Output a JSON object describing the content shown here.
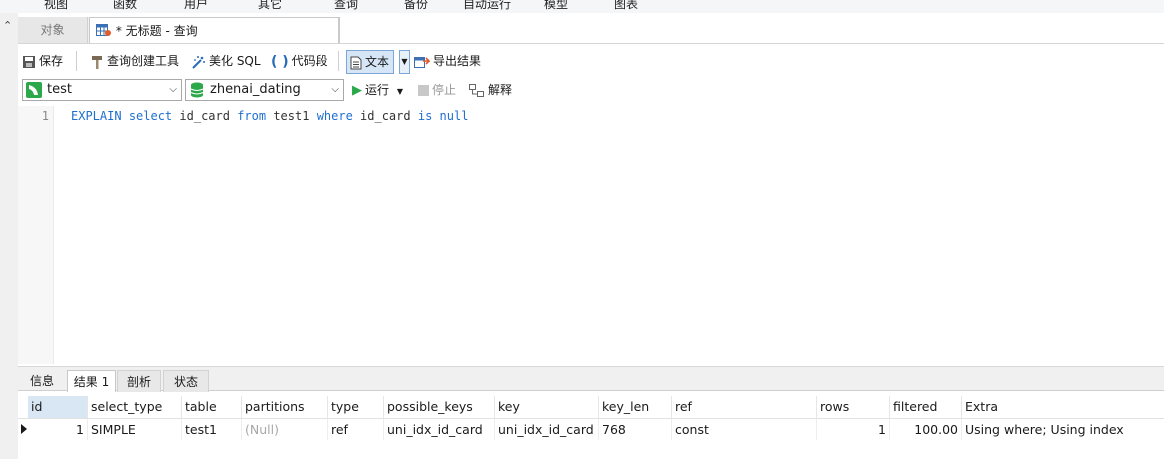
{
  "menu": {
    "items": [
      "视图",
      "函数",
      "用户",
      "其它",
      "查询",
      "备份",
      "自动运行",
      "模型",
      "图表"
    ]
  },
  "tabs": {
    "objects": "对象",
    "query": "* 无标题 - 查询"
  },
  "toolbar": {
    "save": "保存",
    "query_builder": "查询创建工具",
    "beautify": "美化 SQL",
    "snippet": "代码段",
    "text": "文本",
    "export": "导出结果"
  },
  "toolbar2": {
    "connection": "test",
    "database": "zhenai_dating",
    "run": "运行",
    "stop": "停止",
    "explain": "解释"
  },
  "editor": {
    "line_number": "1",
    "code": {
      "t1": "EXPLAIN",
      "t2": "select",
      "t3": " id_card ",
      "t4": "from",
      "t5": " test1 ",
      "t6": "where",
      "t7": " id_card ",
      "t8": "is",
      "t9": "null"
    }
  },
  "result_tabs": {
    "info": "信息",
    "result1": "结果 1",
    "profile": "剖析",
    "status": "状态"
  },
  "grid": {
    "columns": [
      "id",
      "select_type",
      "table",
      "partitions",
      "type",
      "possible_keys",
      "key",
      "key_len",
      "ref",
      "rows",
      "filtered",
      "Extra"
    ],
    "rows": [
      [
        "1",
        "SIMPLE",
        "test1",
        "(Null)",
        "ref",
        "uni_idx_id_card",
        "uni_idx_id_card",
        "768",
        "const",
        "1",
        "100.00",
        "Using where; Using index"
      ]
    ]
  },
  "colors": {
    "keyword": "#1f6fd0",
    "selected_header": "#d9e6f4",
    "null_text": "#a8a8a8"
  }
}
